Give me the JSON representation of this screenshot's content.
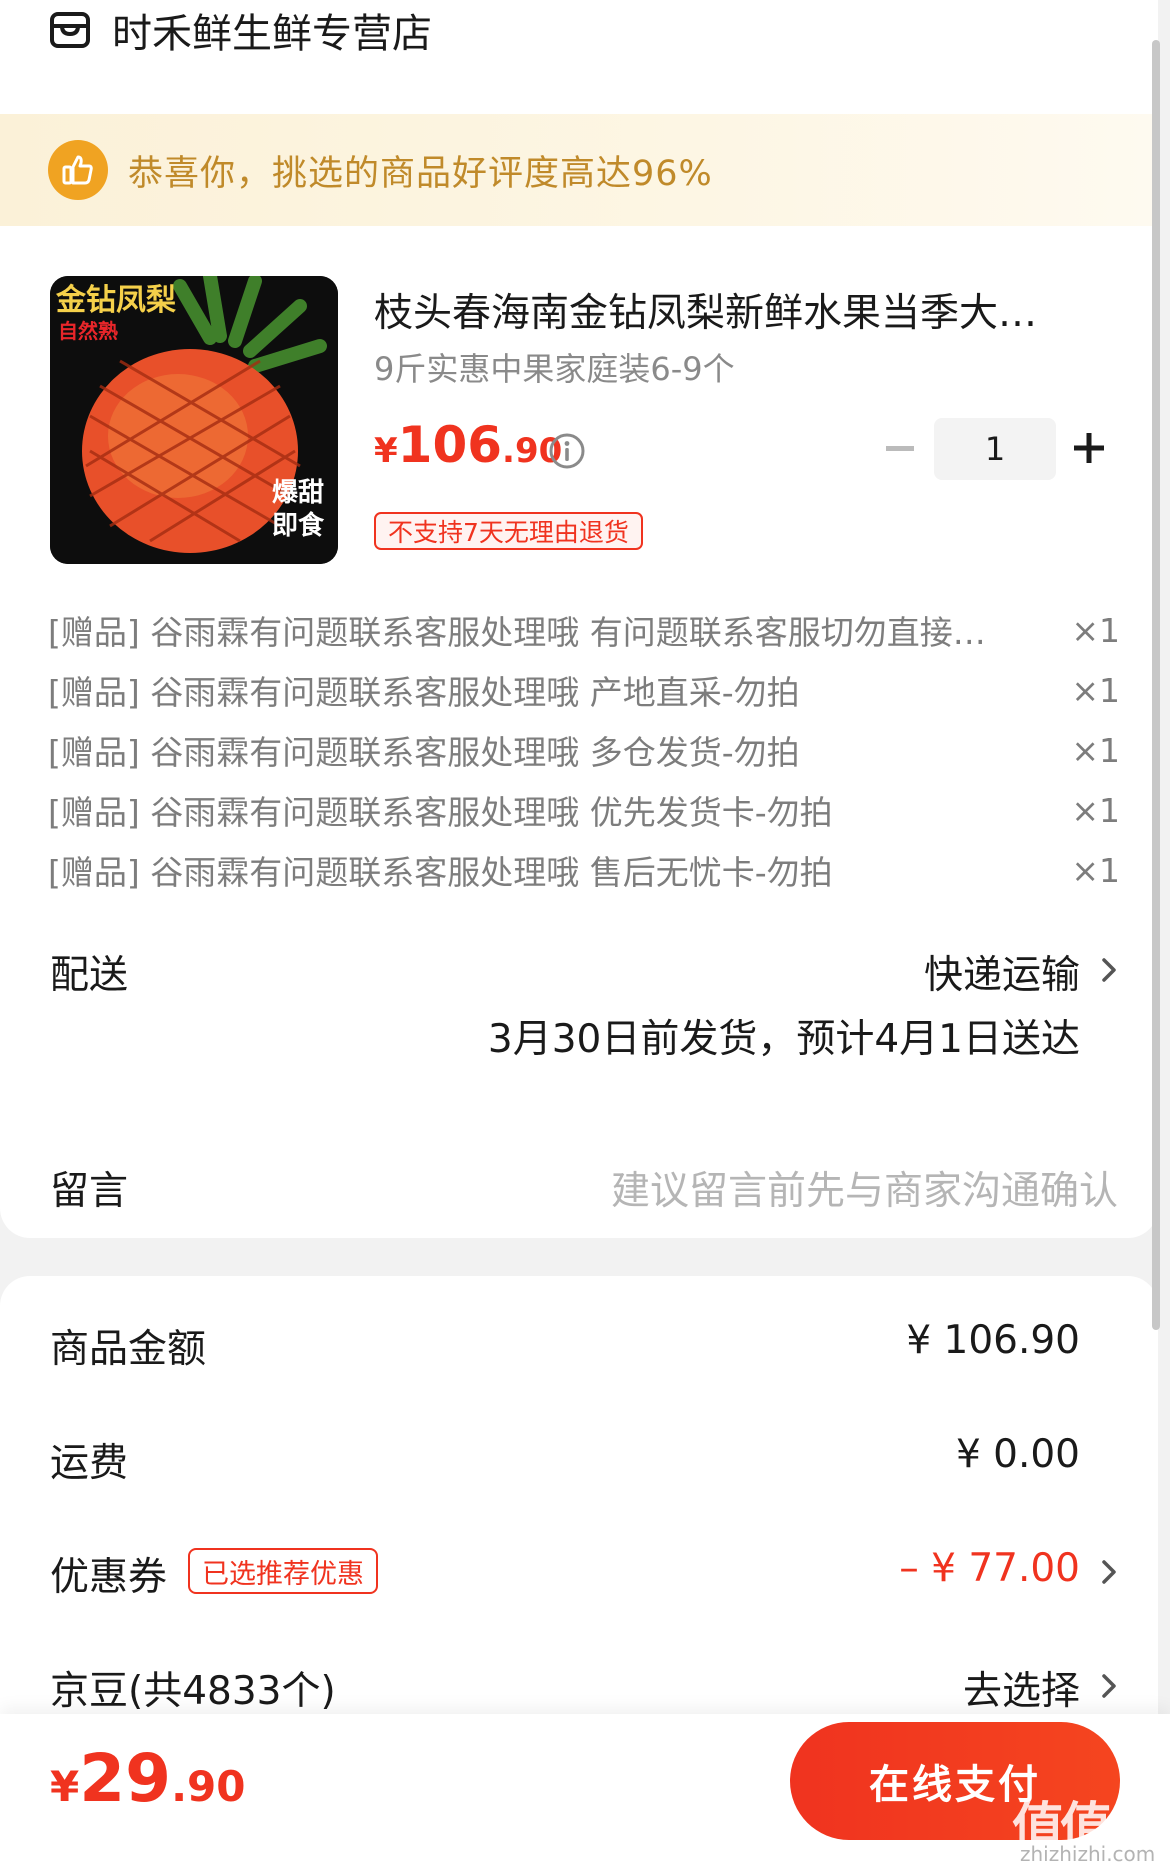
{
  "shop": {
    "name": "时禾鲜生鲜专营店"
  },
  "notice": {
    "text": "恭喜你，挑选的商品好评度高达96%"
  },
  "product": {
    "image_text_top": "金钻凤梨",
    "image_text_sub": "自然熟",
    "image_text_bottom_1": "爆甜",
    "image_text_bottom_2": "即食",
    "title": "枝头春海南金钻凤梨新鲜水果当季大…",
    "spec": "9斤实惠中果家庭装6-9个",
    "price_currency": "¥",
    "price_int": "106",
    "price_dec": ".90",
    "quantity": "1",
    "return_tag": "不支持7天无理由退货"
  },
  "gifts": [
    {
      "text": "[赠品] 谷雨霖有问题联系客服处理哦 有问题联系客服切勿直接…",
      "qty": "×1"
    },
    {
      "text": "[赠品] 谷雨霖有问题联系客服处理哦 产地直采-勿拍",
      "qty": "×1"
    },
    {
      "text": "[赠品] 谷雨霖有问题联系客服处理哦 多仓发货-勿拍",
      "qty": "×1"
    },
    {
      "text": "[赠品] 谷雨霖有问题联系客服处理哦 优先发货卡-勿拍",
      "qty": "×1"
    },
    {
      "text": "[赠品] 谷雨霖有问题联系客服处理哦 售后无忧卡-勿拍",
      "qty": "×1"
    }
  ],
  "delivery": {
    "label": "配送",
    "method": "快递运输",
    "date": "3月30日前发货，预计4月1日送达"
  },
  "message": {
    "label": "留言",
    "placeholder": "建议留言前先与商家沟通确认"
  },
  "amounts": {
    "goods_label": "商品金额",
    "goods_value": "¥ 106.90",
    "shipping_label": "运费",
    "shipping_value": "¥ 0.00",
    "coupon_label": "优惠券",
    "coupon_tag": "已选推荐优惠",
    "coupon_value": "– ¥ 77.00",
    "beans_label": "京豆(共4833个)",
    "beans_action": "去选择"
  },
  "footer": {
    "total_currency": "¥",
    "total_int": "29",
    "total_dec": ".90",
    "pay_label": "在线支付"
  },
  "watermark": {
    "main": "值值值",
    "sub": "zhizhizhi.com"
  },
  "colors": {
    "accent": "#f0331f",
    "notice_text": "#c08a2a",
    "notice_icon": "#f0a322"
  }
}
